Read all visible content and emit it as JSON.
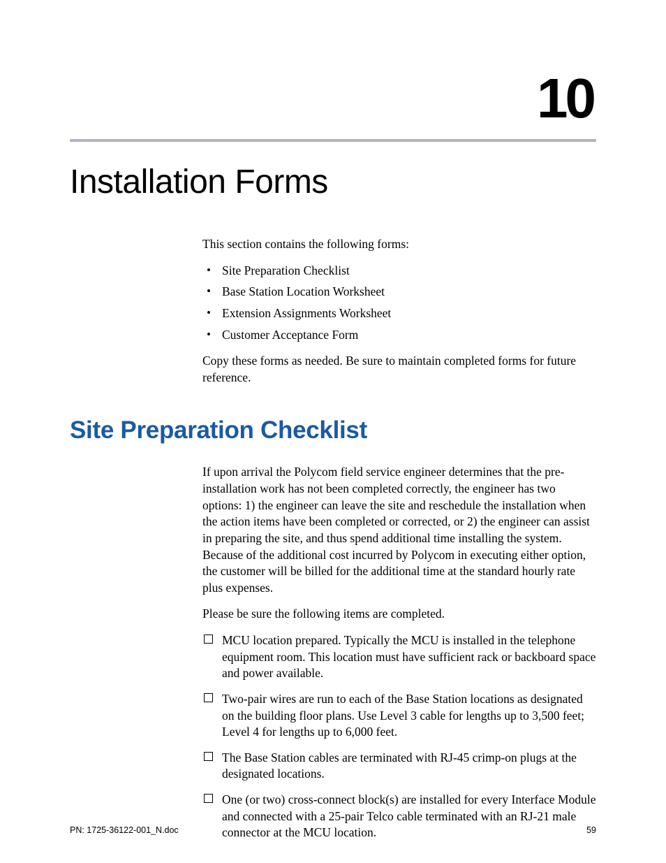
{
  "chapter": {
    "number": "10",
    "title": "Installation Forms"
  },
  "intro": {
    "lead": "This section contains the following forms:",
    "items": [
      "Site Preparation Checklist",
      "Base Station Location Worksheet",
      "Extension Assignments Worksheet",
      "Customer Acceptance Form"
    ],
    "followup": "Copy these forms as needed. Be sure to maintain completed forms for future reference."
  },
  "section": {
    "heading": "Site Preparation Checklist",
    "para1": "If upon arrival the Polycom field service engineer determines that the pre-installation work has not been completed correctly, the engineer has two options: 1) the engineer can leave the site and reschedule the installation when the action items have been completed or corrected, or 2) the engineer can assist in preparing the site, and thus spend additional time installing the system. Because of the additional cost incurred by Polycom in executing either option, the customer will be billed for the additional time at the standard hourly rate plus expenses.",
    "para2": "Please be sure the following items are completed.",
    "checklist": [
      "MCU location prepared. Typically the MCU is installed in the telephone equipment room. This location must have sufficient rack or backboard space and power available.",
      "Two-pair wires are run to each of the Base Station locations as designated on the building floor plans. Use Level 3 cable for lengths up to 3,500 feet; Level 4 for lengths up to 6,000 feet.",
      "The Base Station cables are terminated with RJ-45 crimp-on plugs at the designated locations.",
      "One (or two) cross-connect block(s) are installed for every Interface Module and connected with a 25-pair Telco cable terminated with an RJ-21 male connector at the MCU location."
    ]
  },
  "footer": {
    "left": "PN: 1725-36122-001_N.doc",
    "right": "59"
  }
}
